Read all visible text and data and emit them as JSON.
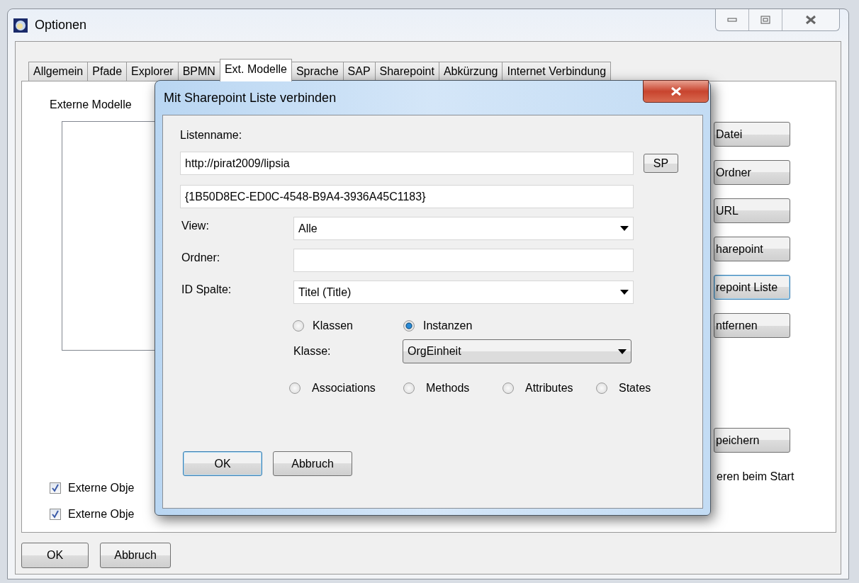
{
  "window": {
    "title": "Optionen"
  },
  "tabs": [
    {
      "label": "Allgemein",
      "selected": false
    },
    {
      "label": "Pfade",
      "selected": false
    },
    {
      "label": "Explorer",
      "selected": false
    },
    {
      "label": "BPMN",
      "selected": false
    },
    {
      "label": "Ext. Modelle",
      "selected": true
    },
    {
      "label": "Sprache",
      "selected": false
    },
    {
      "label": "SAP",
      "selected": false
    },
    {
      "label": "Sharepoint",
      "selected": false
    },
    {
      "label": "Abkürzung",
      "selected": false
    },
    {
      "label": "Internet Verbindung",
      "selected": false
    }
  ],
  "panel": {
    "section_label": "Externe Modelle",
    "side_buttons": [
      {
        "label": "Datei",
        "focused": false
      },
      {
        "label": "Ordner",
        "focused": false
      },
      {
        "label": "URL",
        "focused": false
      },
      {
        "label": "harepoint",
        "focused": false
      },
      {
        "label": "repoint Liste",
        "focused": true
      },
      {
        "label": "ntfernen",
        "focused": false
      }
    ],
    "save_button": "peichern",
    "checkboxes": [
      {
        "label": "Externe Obje",
        "checked": true
      },
      {
        "label": "Externe Obje",
        "checked": true
      }
    ],
    "right_option": "eren beim Start"
  },
  "buttons": [
    "OK",
    "Abbruch"
  ],
  "dialog": {
    "title": "Mit Sharepoint Liste verbinden",
    "list_label": "Listenname:",
    "url": "http://pirat2009/lipsia",
    "sp_button": "SP",
    "list_id": "{1B50D8EC-ED0C-4548-B9A4-3936A45C1183}",
    "fields": [
      {
        "kind": "combo",
        "label": "View:",
        "value": "Alle"
      },
      {
        "kind": "text",
        "label": "Ordner:"
      },
      {
        "kind": "combo",
        "label": "ID Spalte:",
        "value": "Titel (Title)"
      }
    ],
    "mode_options": [
      {
        "label": "Klassen",
        "selected": false
      },
      {
        "label": "Instanzen",
        "selected": true
      }
    ],
    "class_label": "Klasse:",
    "class_value": "OrgEinheit",
    "member_options": [
      {
        "label": "Associations",
        "selected": false
      },
      {
        "label": "Methods",
        "selected": false
      },
      {
        "label": "Attributes",
        "selected": false
      },
      {
        "label": "States",
        "selected": false
      }
    ],
    "buttons": [
      {
        "label": "OK",
        "focused": true
      },
      {
        "label": "Abbruch",
        "focused": false
      }
    ]
  }
}
